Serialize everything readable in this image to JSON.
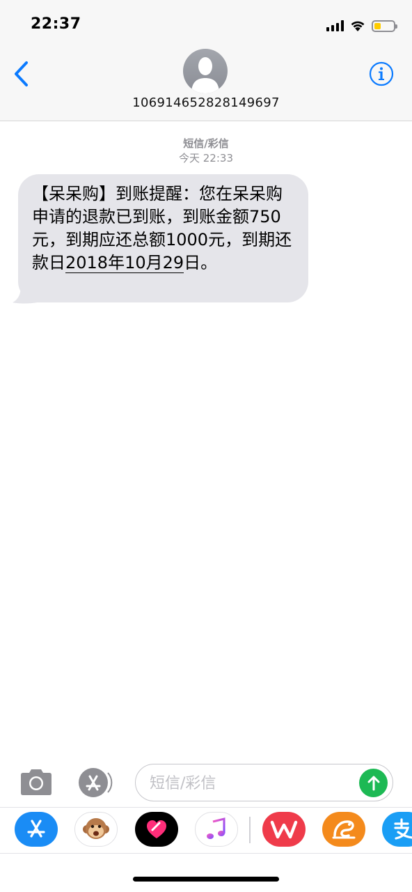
{
  "status_bar": {
    "time": "22:37"
  },
  "header": {
    "contact": "106914652828149697"
  },
  "thread": {
    "message_type": "短信/彩信",
    "timestamp": "今天 22:33",
    "messages": [
      {
        "text": "【呆呆购】到账提醒：您在呆呆购申请的退款已到账，到账金额750元，到期应还总额1000元，到期还款日",
        "date_link": "2018年10月29",
        "text_end": "日。"
      }
    ]
  },
  "composer": {
    "placeholder": "短信/彩信"
  },
  "colors": {
    "accent": "#0a7aff",
    "bubble": "#e5e5ea",
    "send": "#1db954",
    "battery": "#ffcc00"
  },
  "app_strip": [
    {
      "name": "app-store-icon"
    },
    {
      "name": "animoji-icon"
    },
    {
      "name": "digital-touch-icon"
    },
    {
      "name": "music-icon"
    },
    {
      "name": "wps-office-icon"
    },
    {
      "name": "uc-browser-icon"
    },
    {
      "name": "alipay-icon"
    }
  ]
}
